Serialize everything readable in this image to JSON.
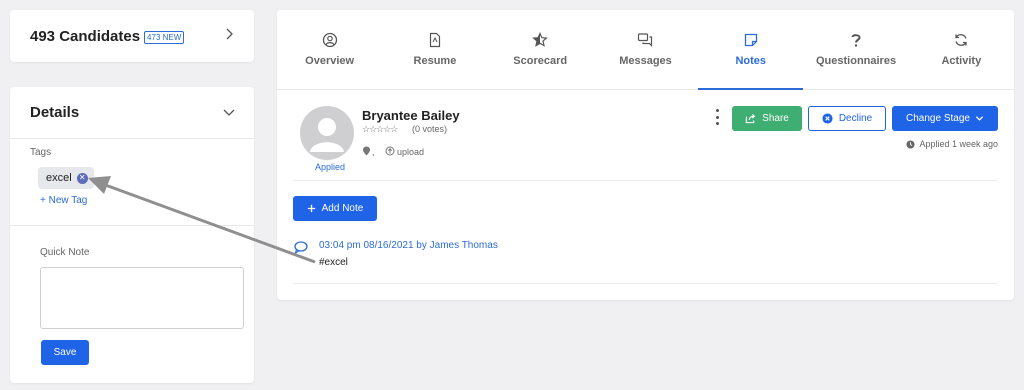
{
  "candidates": {
    "title": "493 Candidates",
    "new_badge": "473 NEW"
  },
  "details": {
    "title": "Details",
    "tags_label": "Tags",
    "tags": [
      {
        "label": "excel"
      }
    ],
    "new_tag_label": "+ New Tag",
    "quick_note_label": "Quick Note",
    "quick_note_value": "",
    "save_label": "Save"
  },
  "tabs": [
    {
      "label": "Overview",
      "icon": "user-circle-icon"
    },
    {
      "label": "Resume",
      "icon": "file-pdf-icon"
    },
    {
      "label": "Scorecard",
      "icon": "star-half-icon"
    },
    {
      "label": "Messages",
      "icon": "chat-bubbles-icon"
    },
    {
      "label": "Notes",
      "icon": "note-icon",
      "active": true
    },
    {
      "label": "Questionnaires",
      "icon": "question-icon"
    },
    {
      "label": "Activity",
      "icon": "refresh-icon"
    }
  ],
  "profile": {
    "name": "Bryantee Bailey",
    "stars": "☆☆☆☆☆",
    "votes": "(0 votes)",
    "status": "Applied",
    "location": ",",
    "source": "upload",
    "applied_ago": "Applied 1 week ago"
  },
  "actions": {
    "share_label": "Share",
    "decline_label": "Decline",
    "change_stage_label": "Change Stage"
  },
  "notes": {
    "add_note_label": "Add Note",
    "items": [
      {
        "meta": "03:04 pm 08/16/2021 by James Thomas",
        "text": "#excel"
      }
    ]
  },
  "colors": {
    "accent": "#1f63e7",
    "share": "#3fae72",
    "link": "#2c6cd8"
  }
}
